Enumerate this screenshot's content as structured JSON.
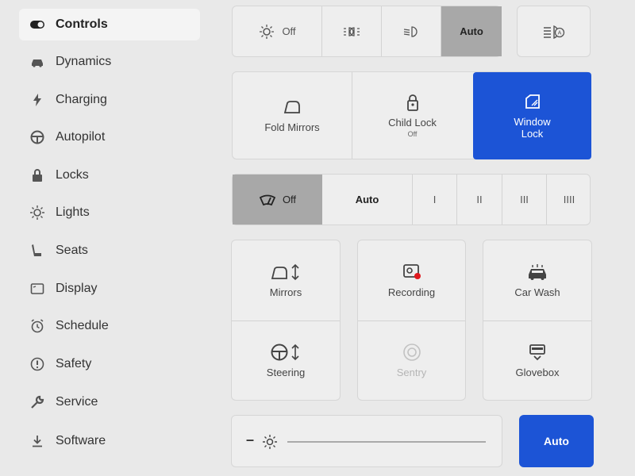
{
  "sidebar": {
    "items": [
      {
        "label": "Controls",
        "icon": "toggle-icon",
        "active": true
      },
      {
        "label": "Dynamics",
        "icon": "car-icon"
      },
      {
        "label": "Charging",
        "icon": "bolt-icon"
      },
      {
        "label": "Autopilot",
        "icon": "steering-wheel-icon"
      },
      {
        "label": "Locks",
        "icon": "lock-icon"
      },
      {
        "label": "Lights",
        "icon": "sun-icon"
      },
      {
        "label": "Seats",
        "icon": "seat-icon"
      },
      {
        "label": "Display",
        "icon": "display-icon"
      },
      {
        "label": "Schedule",
        "icon": "alarm-icon"
      },
      {
        "label": "Safety",
        "icon": "alert-circle-icon"
      },
      {
        "label": "Service",
        "icon": "wrench-icon"
      },
      {
        "label": "Software",
        "icon": "download-icon"
      }
    ]
  },
  "lights_row": {
    "off_label": "Off",
    "auto_label": "Auto",
    "selected": "Auto"
  },
  "quick_row": {
    "fold_mirrors": "Fold Mirrors",
    "child_lock": "Child Lock",
    "child_lock_state": "Off",
    "window_lock": "Window Lock"
  },
  "wipers": {
    "off_label": "Off",
    "auto_label": "Auto",
    "speeds": [
      "I",
      "II",
      "III",
      "IIII"
    ],
    "selected": "Off"
  },
  "tiles": {
    "mirrors": "Mirrors",
    "recording": "Recording",
    "car_wash": "Car Wash",
    "steering": "Steering",
    "sentry": "Sentry",
    "glovebox": "Glovebox"
  },
  "brightness": {
    "minus": "–",
    "auto_label": "Auto"
  },
  "colors": {
    "accent": "#1c54d6",
    "selected_segment": "#a8a8a8",
    "record_dot": "#e0191e"
  }
}
